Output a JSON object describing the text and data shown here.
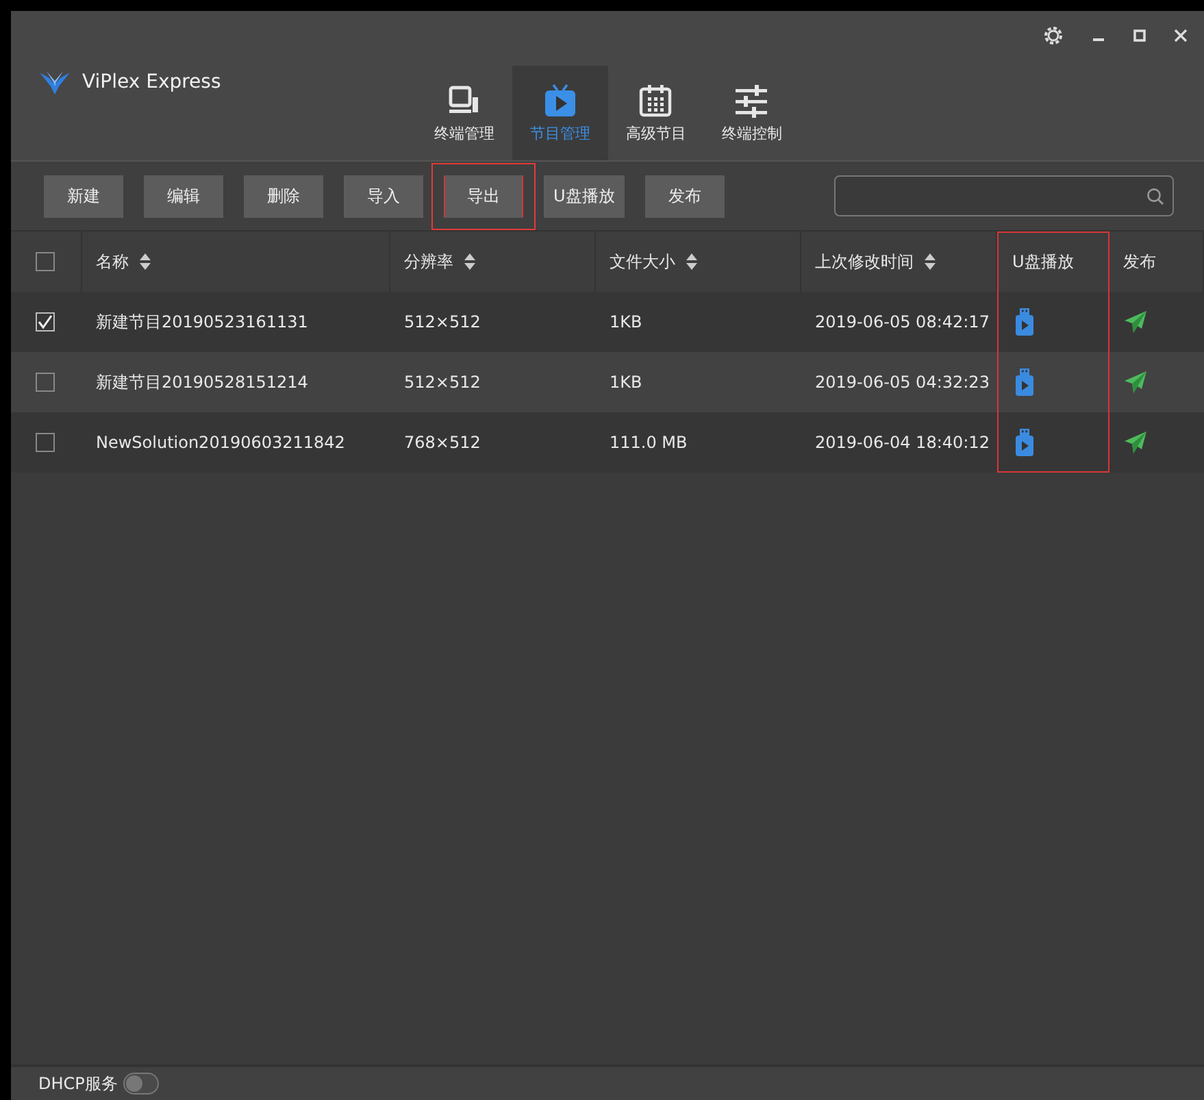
{
  "app": {
    "title": "ViPlex Express"
  },
  "nav_tabs": [
    {
      "label": "终端管理",
      "kind": "monitor",
      "selected": false
    },
    {
      "label": "节目管理",
      "kind": "play",
      "selected": true
    },
    {
      "label": "高级节目",
      "kind": "calendar",
      "selected": false
    },
    {
      "label": "终端控制",
      "kind": "sliders",
      "selected": false
    }
  ],
  "toolbar": {
    "buttons": [
      {
        "label": "新建",
        "highlighted": false
      },
      {
        "label": "编辑",
        "highlighted": false
      },
      {
        "label": "删除",
        "highlighted": false
      },
      {
        "label": "导入",
        "highlighted": false
      },
      {
        "label": "导出",
        "highlighted": true
      },
      {
        "label": "U盘播放",
        "highlighted": false
      },
      {
        "label": "发布",
        "highlighted": false
      }
    ]
  },
  "table": {
    "select_all": {
      "checked": false
    },
    "columns": [
      {
        "label": "名称",
        "sortable": true,
        "highlighted": false
      },
      {
        "label": "分辨率",
        "sortable": true,
        "highlighted": false
      },
      {
        "label": "文件大小",
        "sortable": true,
        "highlighted": false
      },
      {
        "label": "上次修改时间",
        "sortable": true,
        "highlighted": false
      },
      {
        "label": "U盘播放",
        "sortable": false,
        "highlighted": true
      },
      {
        "label": "发布",
        "sortable": false,
        "highlighted": false
      }
    ],
    "rows": [
      {
        "checked": true,
        "name": "新建节目20190523161131",
        "resolution": "512×512",
        "size": "1KB",
        "modified": "2019-06-05 08:42:17"
      },
      {
        "checked": false,
        "name": "新建节目20190528151214",
        "resolution": "512×512",
        "size": "1KB",
        "modified": "2019-06-05 04:32:23"
      },
      {
        "checked": false,
        "name": "NewSolution20190603211842",
        "resolution": "768×512",
        "size": "111.0 MB",
        "modified": "2019-06-04 18:40:12"
      }
    ]
  },
  "status_bar": {
    "label": "DHCP服务",
    "dhcp_on": false
  }
}
